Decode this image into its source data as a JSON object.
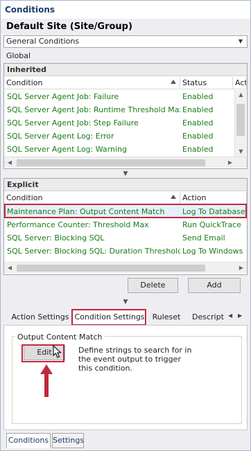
{
  "window": {
    "title": "Conditions",
    "site_title": "Default Site (Site/Group)",
    "scope_select": "General Conditions",
    "scope_label": "Global"
  },
  "inherited": {
    "header": "Inherited",
    "columns": [
      "Condition",
      "Status",
      "Act"
    ],
    "rows": [
      {
        "condition": "SQL Server Agent Job: Failure",
        "status": "Enabled"
      },
      {
        "condition": "SQL Server Agent Job: Runtime Threshold Max",
        "status": "Enabled"
      },
      {
        "condition": "SQL Server Agent Job: Step Failure",
        "status": "Enabled"
      },
      {
        "condition": "SQL Server Agent Log: Error",
        "status": "Enabled"
      },
      {
        "condition": "SQL Server Agent Log: Warning",
        "status": "Enabled"
      }
    ]
  },
  "explicit": {
    "header": "Explicit",
    "columns": [
      "Condition",
      "Action"
    ],
    "rows": [
      {
        "condition": "Maintenance Plan: Output Content Match",
        "action": "Log To Database"
      },
      {
        "condition": "Performance Counter: Threshold Max",
        "action": "Run QuickTrace"
      },
      {
        "condition": "SQL Server: Blocking SQL",
        "action": "Send Email"
      },
      {
        "condition": "SQL Server: Blocking SQL: Duration Threshold Max",
        "action": "Log To Windows Ev"
      }
    ],
    "delete_label": "Delete",
    "add_label": "Add"
  },
  "tabs": [
    "Action Settings",
    "Condition Settings",
    "Ruleset",
    "Descripti"
  ],
  "condition_settings": {
    "group_title": "Output Content Match",
    "edit_label": "Edit",
    "description": "Define strings to search for in the event output to trigger this condition."
  },
  "bottom_tabs": [
    "Conditions",
    "Settings"
  ],
  "colors": {
    "title_blue": "#1f3d6e",
    "enabled_green": "#1a7a1a",
    "highlight_red": "#c0283d",
    "selected_row": "#e5f0fb"
  }
}
